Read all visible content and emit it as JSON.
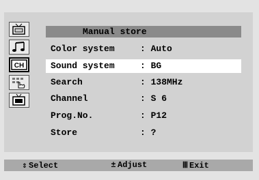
{
  "menu": {
    "title": "Manual store",
    "rows": [
      {
        "label": "Color system",
        "value": ": Auto"
      },
      {
        "label": "Sound system",
        "value": ": BG"
      },
      {
        "label": "Search",
        "value": ": 138MHz"
      },
      {
        "label": "Channel",
        "value": ": S 6"
      },
      {
        "label": "Prog.No.",
        "value": ": P12"
      },
      {
        "label": "Store",
        "value": ": ?"
      }
    ],
    "selected_index": 1
  },
  "sidebar": {
    "icons": [
      {
        "name": "picture-icon"
      },
      {
        "name": "sound-icon"
      },
      {
        "name": "channel-icon",
        "text": "CH",
        "active": true
      },
      {
        "name": "function-icon"
      },
      {
        "name": "setup-icon"
      }
    ]
  },
  "footer": {
    "select_glyph": "⇕",
    "select_label": "Select",
    "adjust_glyph": "±",
    "adjust_label": "Adjust",
    "exit_glyph": "Ⅲ",
    "exit_label": "Exit"
  },
  "colors": {
    "title_bar": "#8a8a8a",
    "selected_row": "#ffffff",
    "footer_bar": "#a9a9a9"
  }
}
